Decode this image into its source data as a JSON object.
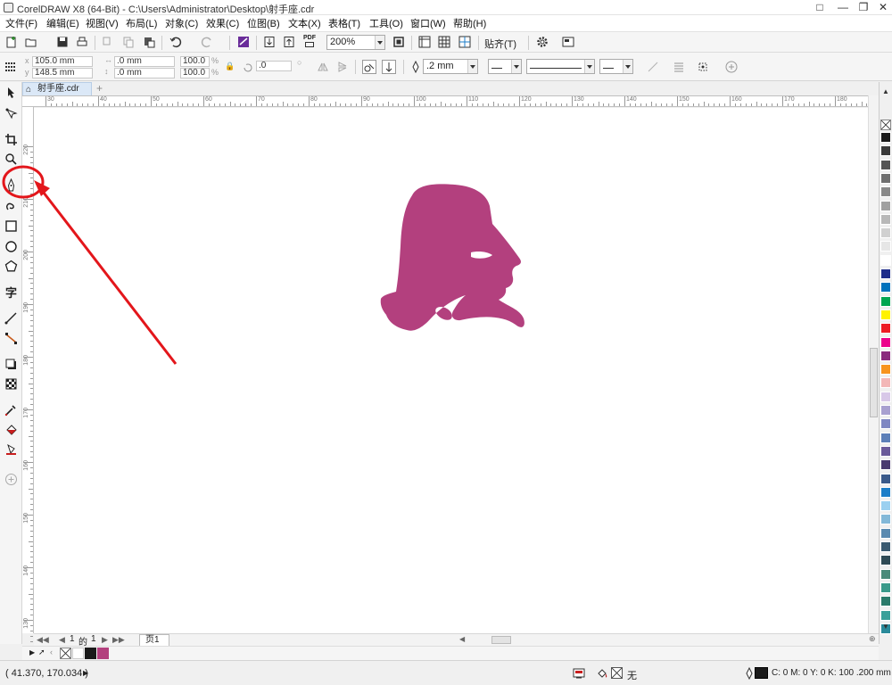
{
  "window": {
    "title": "CorelDRAW X8 (64-Bit) - C:\\Users\\Administrator\\Desktop\\射手座.cdr"
  },
  "menu": {
    "items": [
      "文件(F)",
      "编辑(E)",
      "视图(V)",
      "布局(L)",
      "对象(C)",
      "效果(C)",
      "位图(B)",
      "文本(X)",
      "表格(T)",
      "工具(O)",
      "窗口(W)",
      "帮助(H)"
    ]
  },
  "toolbar": {
    "pdf_label": "PDF",
    "zoom_value": "200%",
    "snap_label": "贴齐(T)"
  },
  "property_bar": {
    "x_value": "105.0 mm",
    "y_value": "148.5 mm",
    "width_value": ".0 mm",
    "height_value": ".0 mm",
    "scale_x": "100.0",
    "scale_y": "100.0",
    "percent_symbol": "%",
    "rotation_value": ".0",
    "outline_width": ".2 mm"
  },
  "document": {
    "tab_label": "射手座.cdr",
    "page_counter_current": "1",
    "page_counter_of": "的",
    "page_counter_total": "1",
    "page_tab_label": "页1",
    "artwork_name": "sagittarius-head-silhouette",
    "artwork_fill": "#b3407e"
  },
  "rulers": {
    "horizontal_labels": [
      "30",
      "40",
      "50",
      "60",
      "70",
      "80",
      "90",
      "100",
      "110",
      "120",
      "130",
      "140",
      "150",
      "160",
      "170",
      "180"
    ],
    "vertical_labels": [
      "220",
      "210",
      "200",
      "190",
      "180",
      "170",
      "160",
      "150",
      "140",
      "130"
    ],
    "unit_label": "毫米"
  },
  "palette": {
    "colors": [
      "#1a1a1a",
      "#3a3a3a",
      "#555555",
      "#6e6e6e",
      "#888888",
      "#a0a0a0",
      "#b8b8b8",
      "#d0d0d0",
      "#e6e6e6",
      "#ffffff",
      "#1f2d8a",
      "#0072bc",
      "#00a651",
      "#fff200",
      "#ed1c24",
      "#ec008c",
      "#8b2a7e",
      "#f7941d",
      "#f3b7b7",
      "#d8c8e8",
      "#a8a0d0",
      "#7e86c2",
      "#5c7fb8",
      "#6a5a9a",
      "#4a3a70",
      "#3a5a8a",
      "#1c7ec8",
      "#9bd0f0",
      "#82b8d8",
      "#5a8ab0",
      "#3a5a70",
      "#2e4a55",
      "#4a8a7a",
      "#3a9a8a",
      "#2a7a6a",
      "#3aa09a",
      "#2a8a9a"
    ],
    "accent": "#b3407e"
  },
  "statusbar": {
    "cursor_coords": "( 41.370, 170.034 )",
    "fill_none_label": "无",
    "outline_info": "C: 0 M: 0 Y: 0 K: 100  .200 mm"
  },
  "annotation": {
    "color": "#e3161b"
  }
}
